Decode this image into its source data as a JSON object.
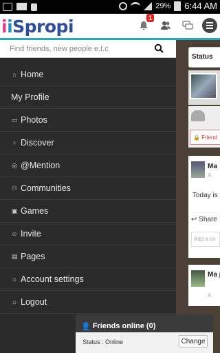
{
  "status_bar": {
    "battery_percent": "29%",
    "time": "6:44 AM"
  },
  "header": {
    "logo_parts": [
      "i",
      "i",
      "Spropi"
    ],
    "notification_count": "1",
    "icons": [
      "notifications-icon",
      "friends-icon",
      "messages-icon",
      "menu-icon"
    ]
  },
  "search": {
    "placeholder": "Find friends, new people e.t.c"
  },
  "nav": {
    "items": [
      {
        "label": "Home",
        "icon": "home-icon"
      },
      {
        "label": "My Profile",
        "icon": ""
      },
      {
        "label": "Photos",
        "icon": "photos-icon"
      },
      {
        "label": "Discover",
        "icon": "discover-icon"
      },
      {
        "label": "@Mention",
        "icon": "mention-icon"
      },
      {
        "label": "Communities",
        "icon": "communities-icon"
      },
      {
        "label": "Games",
        "icon": "games-icon"
      },
      {
        "label": "Invite",
        "icon": "invite-icon"
      },
      {
        "label": "Pages",
        "icon": "pages-icon"
      },
      {
        "label": "Account settings",
        "icon": "home-icon"
      },
      {
        "label": "Logout",
        "icon": "home-icon"
      }
    ]
  },
  "content": {
    "tab_label": "Status",
    "friend_button": "Friend",
    "post1": {
      "name": "Ma",
      "sub": "A",
      "text": "Today is",
      "share": "Share",
      "comment_placeholder": "Add a co"
    },
    "post2": {
      "name": "Ma pho",
      "sub": "A"
    }
  },
  "friends_online": {
    "title": "Friends online (0)",
    "status_text": "Status : Online",
    "change_label": "Change"
  }
}
